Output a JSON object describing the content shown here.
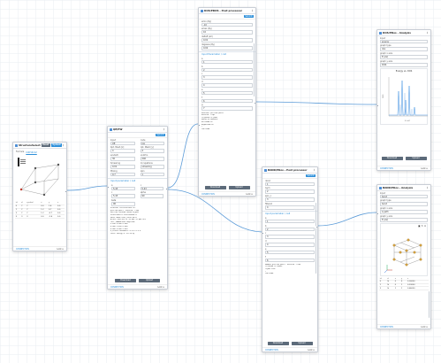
{
  "colors": {
    "accent": "#2d8fd9",
    "wire": "#5b9bd8",
    "grid": "#e9edf2"
  },
  "node_structure": {
    "title": "StructureSelector",
    "btn_a": "Reset",
    "btn_b": "Upload",
    "formula_label": "Formula",
    "formula": "C6H4O2",
    "table_headers": [
      "id",
      "el",
      "symbol",
      "x",
      "y",
      "z"
    ],
    "table_rows": [
      [
        "0",
        "C",
        "C",
        "0.0",
        "1.4",
        "0.0"
      ],
      [
        "1",
        "C",
        "C",
        "1.2",
        "0.7",
        "0.0"
      ],
      [
        "2",
        "C",
        "C",
        "1.2",
        "-0.7",
        "0.0"
      ],
      [
        "3",
        "O",
        "O",
        "0.0",
        "-1.4",
        "0.0"
      ]
    ],
    "footer_left": "CONNECTION",
    "footer_right": "Lock ⊙"
  },
  "node_qe": {
    "title": "QE/PW",
    "submit": "Submit",
    "fields": [
      {
        "label": "Input",
        "value": "QE"
      },
      {
        "label": "Code",
        "value": "pw"
      },
      {
        "label": "Kpt. Mesh [x]",
        "value": "4"
      },
      {
        "label": "Kpt. Mesh [y]",
        "value": "4"
      },
      {
        "label": "ecutwfc",
        "value": "30"
      },
      {
        "label": "ecutrho",
        "value": "240"
      },
      {
        "label": "Smearing",
        "value": "0.01"
      },
      {
        "label": "Occupations",
        "value": "smearing"
      },
      {
        "label": "Mixing",
        "value": "0.7"
      },
      {
        "label": "Spin",
        "value": "1"
      }
    ],
    "section": "Input parameter / cell",
    "params": [
      {
        "label": "a",
        "value": "5.43"
      },
      {
        "label": "b",
        "value": "5.43"
      },
      {
        "label": "c",
        "value": "5.43"
      },
      {
        "label": "alpha",
        "value": "90"
      },
      {
        "label": "beta",
        "value": "90"
      }
    ],
    "log": [
      "&CONTROL  calculation='scf'",
      "  prefix='pwscf' outdir='./tmp'",
      "&SYSTEM ibrav=0 nat=8 ntyp=1",
      "  ecutwfc=30.0 ecutrho=240.0",
      "&ELECTRONS conv_thr=1.0d-8",
      "ATOMIC_SPECIES Si 28.086 Si.pbe.UPF",
      "CELL_PARAMETERS angstrom",
      "  5.430 0.000 0.000",
      "  0.000 5.430 0.000",
      "  0.000 0.000 5.430",
      "K_POINTS automatic 4 4 4 0 0 0",
      "total energy = -63.24 Ry"
    ],
    "download": "Download",
    "upload": "Upload",
    "footer_left": "CONNECTION",
    "footer_right": "Lock ⊙"
  },
  "node_post1": {
    "title": "DOS/PDOS - Post processor",
    "submit": "Submit",
    "fields": [
      {
        "label": "emin (Ry)",
        "value": "-10"
      },
      {
        "label": "emax (Ry)",
        "value": "10"
      },
      {
        "label": "deltaE (eV)",
        "value": "0.01"
      },
      {
        "label": "degauss (Ry)",
        "value": "0.02"
      }
    ],
    "section": "Input Parameter / cell",
    "params": [
      {
        "label": "a",
        "value": "1"
      },
      {
        "label": "b",
        "value": "2"
      },
      {
        "label": "c",
        "value": "3"
      },
      {
        "label": "d",
        "value": "4"
      },
      {
        "label": "e",
        "value": "5"
      },
      {
        "label": "f",
        "value": "6"
      },
      {
        "label": "g",
        "value": "7"
      }
    ],
    "log": [
      "&PROJWFC prefix='pwscf'",
      "  outdir='./tmp'",
      "  filpdos='si.pdos'",
      "  Emin=-10 Emax=10",
      "  DeltaE=0.01",
      "  degauss=0.02",
      "/",
      "JOB DONE."
    ],
    "download": "Download",
    "upload": "Upload",
    "footer_left": "CONNECTION",
    "footer_right": "Lock ⊙"
  },
  "node_post2": {
    "title": "BAND/PDos - Post processor",
    "submit": "Submit",
    "fields": [
      {
        "label": "nbnd",
        "value": "1"
      },
      {
        "label": "lsym",
        "value": "2"
      },
      {
        "label": "spin_c",
        "value": "3"
      },
      {
        "label": "filband",
        "value": "4"
      }
    ],
    "section": "Input parameter / cell",
    "params": [
      {
        "label": "a",
        "value": "1"
      },
      {
        "label": "b",
        "value": "2"
      },
      {
        "label": "c",
        "value": "3"
      },
      {
        "label": "d",
        "value": "4"
      },
      {
        "label": "e",
        "value": "5"
      },
      {
        "label": "f",
        "value": "6"
      }
    ],
    "log": [
      "&BANDS prefix='pwscf' outdir='./tmp'",
      "  filband='si.bands'",
      "  lsym=.true.",
      "/",
      "JOB DONE."
    ],
    "download": "Download",
    "upload": "Upload",
    "footer_left": "CONNECTION",
    "footer_right": "Lock ⊙"
  },
  "node_analysis1": {
    "title": "DOS/PDos - Analysis",
    "fields": [
      {
        "label": "Input",
        "value": "energy"
      },
      {
        "label": "graph type",
        "value": "dos"
      },
      {
        "label": "graph x axis",
        "value": "E (eV)"
      },
      {
        "label": "graph y axis",
        "value": "DOS"
      }
    ],
    "plot_title": "Energy vs. DOS",
    "ylabel": "DOS",
    "xlabel": "E (eV)",
    "download": "Download",
    "upload": "Upload",
    "footer_left": "CONNECTION",
    "footer_right": "Lock ⊙"
  },
  "node_analysis2": {
    "title": "BAND/PDos - Analysis",
    "fields": [
      {
        "label": "Input",
        "value": "band"
      },
      {
        "label": "graph type",
        "value": "band"
      },
      {
        "label": "graph x axis",
        "value": "k-path"
      },
      {
        "label": "graph y axis",
        "value": "E (eV)"
      }
    ],
    "table_headers": [
      "id",
      "el",
      "x",
      "y",
      "z"
    ],
    "table_rows": [
      [
        "0",
        "Si",
        "0",
        "0",
        "0.00000"
      ],
      [
        "1",
        "Si",
        "0",
        "1",
        "0.33000"
      ],
      [
        "2",
        "Si",
        "1",
        "1",
        "0.66000"
      ]
    ],
    "footer_left": "CONNECTION",
    "footer_right": "Lock ⊙"
  }
}
